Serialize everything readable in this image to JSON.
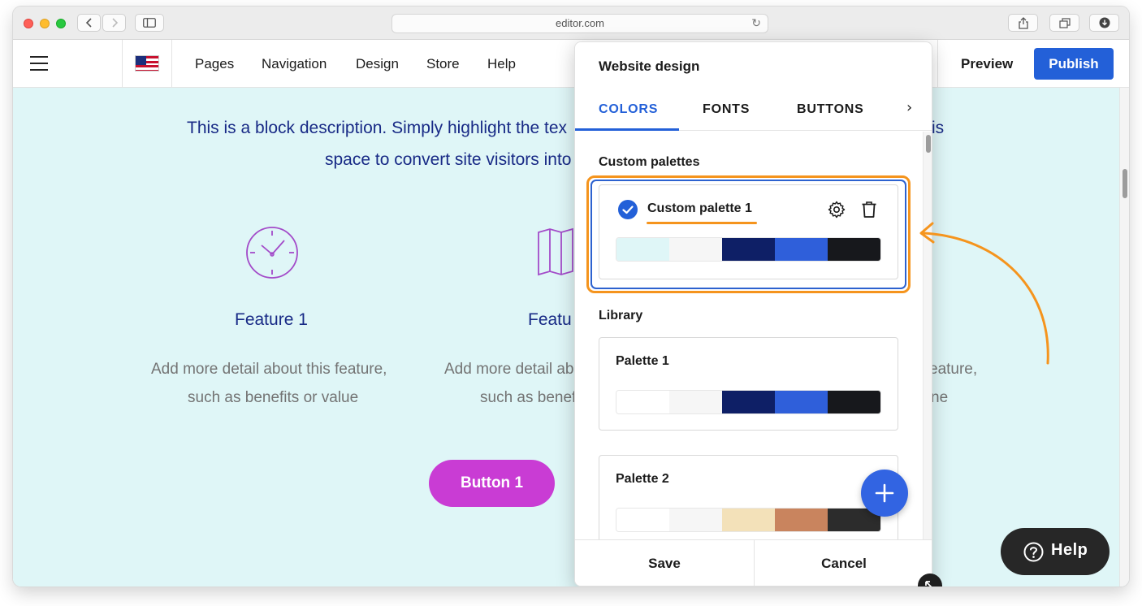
{
  "browser": {
    "address": "editor.com",
    "traffic_colors": [
      "#fe5f57",
      "#febc2e",
      "#28c840"
    ]
  },
  "toolbar": {
    "nav": [
      "Pages",
      "Navigation",
      "Design",
      "Store",
      "Help"
    ],
    "preview_label": "Preview",
    "publish_label": "Publish"
  },
  "page": {
    "description_line1": "This is a block description. Simply highlight the tex",
    "description_line1_tail": "is",
    "description_line2": "space to convert site visitors into",
    "features": [
      {
        "title": "Feature 1",
        "line1": "Add more detail about this feature,",
        "line2": "such as benefits or value"
      },
      {
        "title": "Featu",
        "line1": "Add more detail ab",
        "line2": "such as benef"
      },
      {
        "title": "",
        "line1": "eature,",
        "line2": "ne"
      }
    ],
    "button_label": "Button 1"
  },
  "panel": {
    "title": "Website design",
    "tabs": [
      {
        "label": "COLORS",
        "active": true
      },
      {
        "label": "FONTS",
        "active": false
      },
      {
        "label": "BUTTONS",
        "active": false
      }
    ],
    "custom_section_label": "Custom palettes",
    "custom_palette": {
      "name": "Custom palette 1",
      "colors": [
        "#dff6f7",
        "#f6f6f6",
        "#0e1f66",
        "#2f5fda",
        "#17181c"
      ]
    },
    "library_label": "Library",
    "library": [
      {
        "name": "Palette 1",
        "colors": [
          "#ffffff",
          "#f6f6f6",
          "#0e1f66",
          "#2f5fda",
          "#17181c"
        ]
      },
      {
        "name": "Palette 2",
        "colors": [
          "#ffffff",
          "#f6f6f6",
          "#f3e1b9",
          "#c9845e",
          "#2c2c2c"
        ]
      }
    ],
    "save_label": "Save",
    "cancel_label": "Cancel"
  },
  "help_widget": {
    "label": "Help"
  },
  "accent_colors": {
    "brand_blue": "#2360d8",
    "annotation_orange": "#f5941d",
    "heading_navy": "#182a86",
    "button_magenta": "#c93cd4"
  }
}
